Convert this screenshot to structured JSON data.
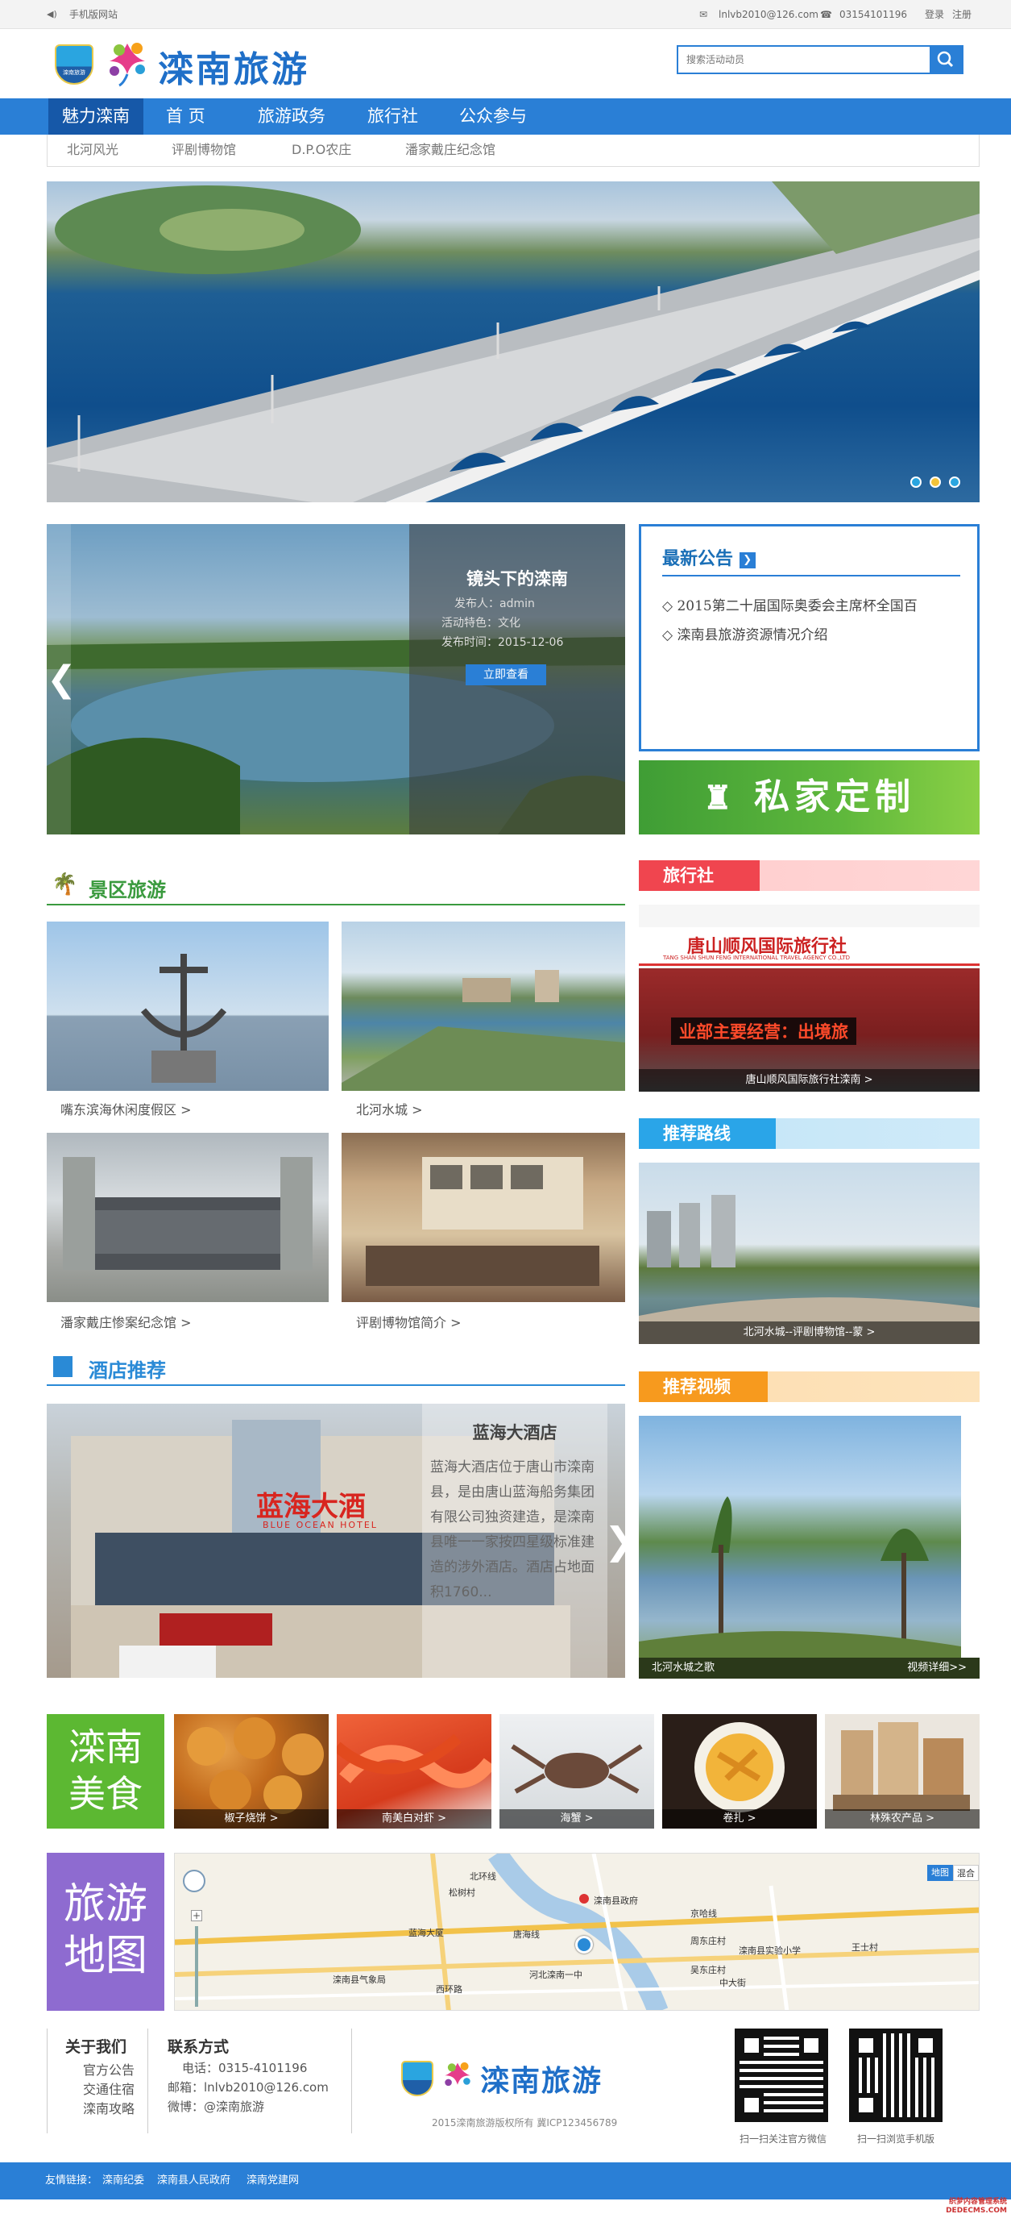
{
  "topbar": {
    "mobile": "手机版网站",
    "email": "lnlvb2010@126.com",
    "phone": "03154101196",
    "login": "登录",
    "register": "注册"
  },
  "brand": {
    "name": "滦南旅游",
    "badge": "滦南旅游"
  },
  "search": {
    "placeholder": "搜索活动动员"
  },
  "nav": {
    "items": [
      "魅力滦南",
      "首 页",
      "旅游政务",
      "旅行社",
      "公众参与"
    ]
  },
  "subnav": {
    "items": [
      "北河风光",
      "评剧博物馆",
      "D.P.O农庄",
      "潘家戴庄纪念馆"
    ]
  },
  "feature": {
    "title": "镜头下的滦南",
    "author": "发布人：admin",
    "feature": "活动特色：文化",
    "time": "发布时间：2015-12-06",
    "button": "立即查看"
  },
  "notice": {
    "title": "最新公告",
    "items": [
      "2015第二十届国际奥委会主席杯全国百",
      "滦南县旅游资源情况介绍"
    ]
  },
  "custom": {
    "label": "私家定制"
  },
  "scenic": {
    "title": "景区旅游",
    "items": [
      "嘴东滨海休闲度假区 >",
      "北河水城 >",
      "潘家戴庄惨案纪念馆 >",
      "评剧博物馆简介 >"
    ]
  },
  "agency": {
    "title": "旅行社",
    "caption": "唐山顺风国际旅行社滦南 >",
    "sign_cn": "唐山顺风国际旅行社",
    "sign_en": "TANG SHAN SHUN FENG INTERNATIONAL TRAVEL AGENCY CO.,LTD",
    "led": "业部主要经营：出境旅"
  },
  "route": {
    "title": "推荐路线",
    "caption": "北河水城--评剧博物馆--蒙 >"
  },
  "hotel": {
    "title": "酒店推荐",
    "name": "蓝海大酒店",
    "desc": "蓝海大酒店位于唐山市滦南县，是由唐山蓝海船务集团有限公司独资建造，是滦南县唯一一家按四星级标准建造的涉外酒店。酒店占地面积1760...",
    "sign": "蓝海大酒",
    "sign_en": "BLUE OCEAN HOTEL"
  },
  "video": {
    "title": "推荐视频",
    "caption": "北河水城之歌",
    "more": "视频详细>>"
  },
  "food": {
    "label1": "滦南",
    "label2": "美食",
    "items": [
      "椒子烧饼 >",
      "南美白对虾 >",
      "海蟹 >",
      "卷扎 >",
      "林殊农产品 >"
    ]
  },
  "map": {
    "label1": "旅游",
    "label2": "地图",
    "roads": [
      "北环线",
      "唐海线",
      "中大街",
      "西环路",
      "京哈线",
      "松树村"
    ],
    "places": [
      "滦南县政府",
      "蓝海大厦",
      "滦南县实验小学",
      "河北滦南一中",
      "周东庄村",
      "吴东庄村",
      "王士村",
      "滦南县气象局"
    ],
    "mapbtn": "地图",
    "satbtn": "混合"
  },
  "footer": {
    "about": {
      "title": "关于我们",
      "items": [
        "官方公告",
        "交通住宿",
        "滦南攻略"
      ]
    },
    "contact": {
      "title": "联系方式",
      "phone": "电话：0315-4101196",
      "email": "邮箱：lnlvb2010@126.com",
      "weibo": "微博：@滦南旅游"
    },
    "copyright": "2015滦南旅游版权所有 冀ICP123456789",
    "qr1": "扫一扫关注官方微信",
    "qr2": "扫一扫浏览手机版"
  },
  "links": {
    "label": "友情链接：",
    "items": [
      "滦南纪委",
      "滦南县人民政府",
      "滦南党建网"
    ]
  },
  "watermark": {
    "line1": "织梦内容管理系统",
    "line2": "DEDECMS.COM"
  },
  "colors": {
    "primary": "#2a7fd6",
    "green": "#3a9a3e"
  }
}
